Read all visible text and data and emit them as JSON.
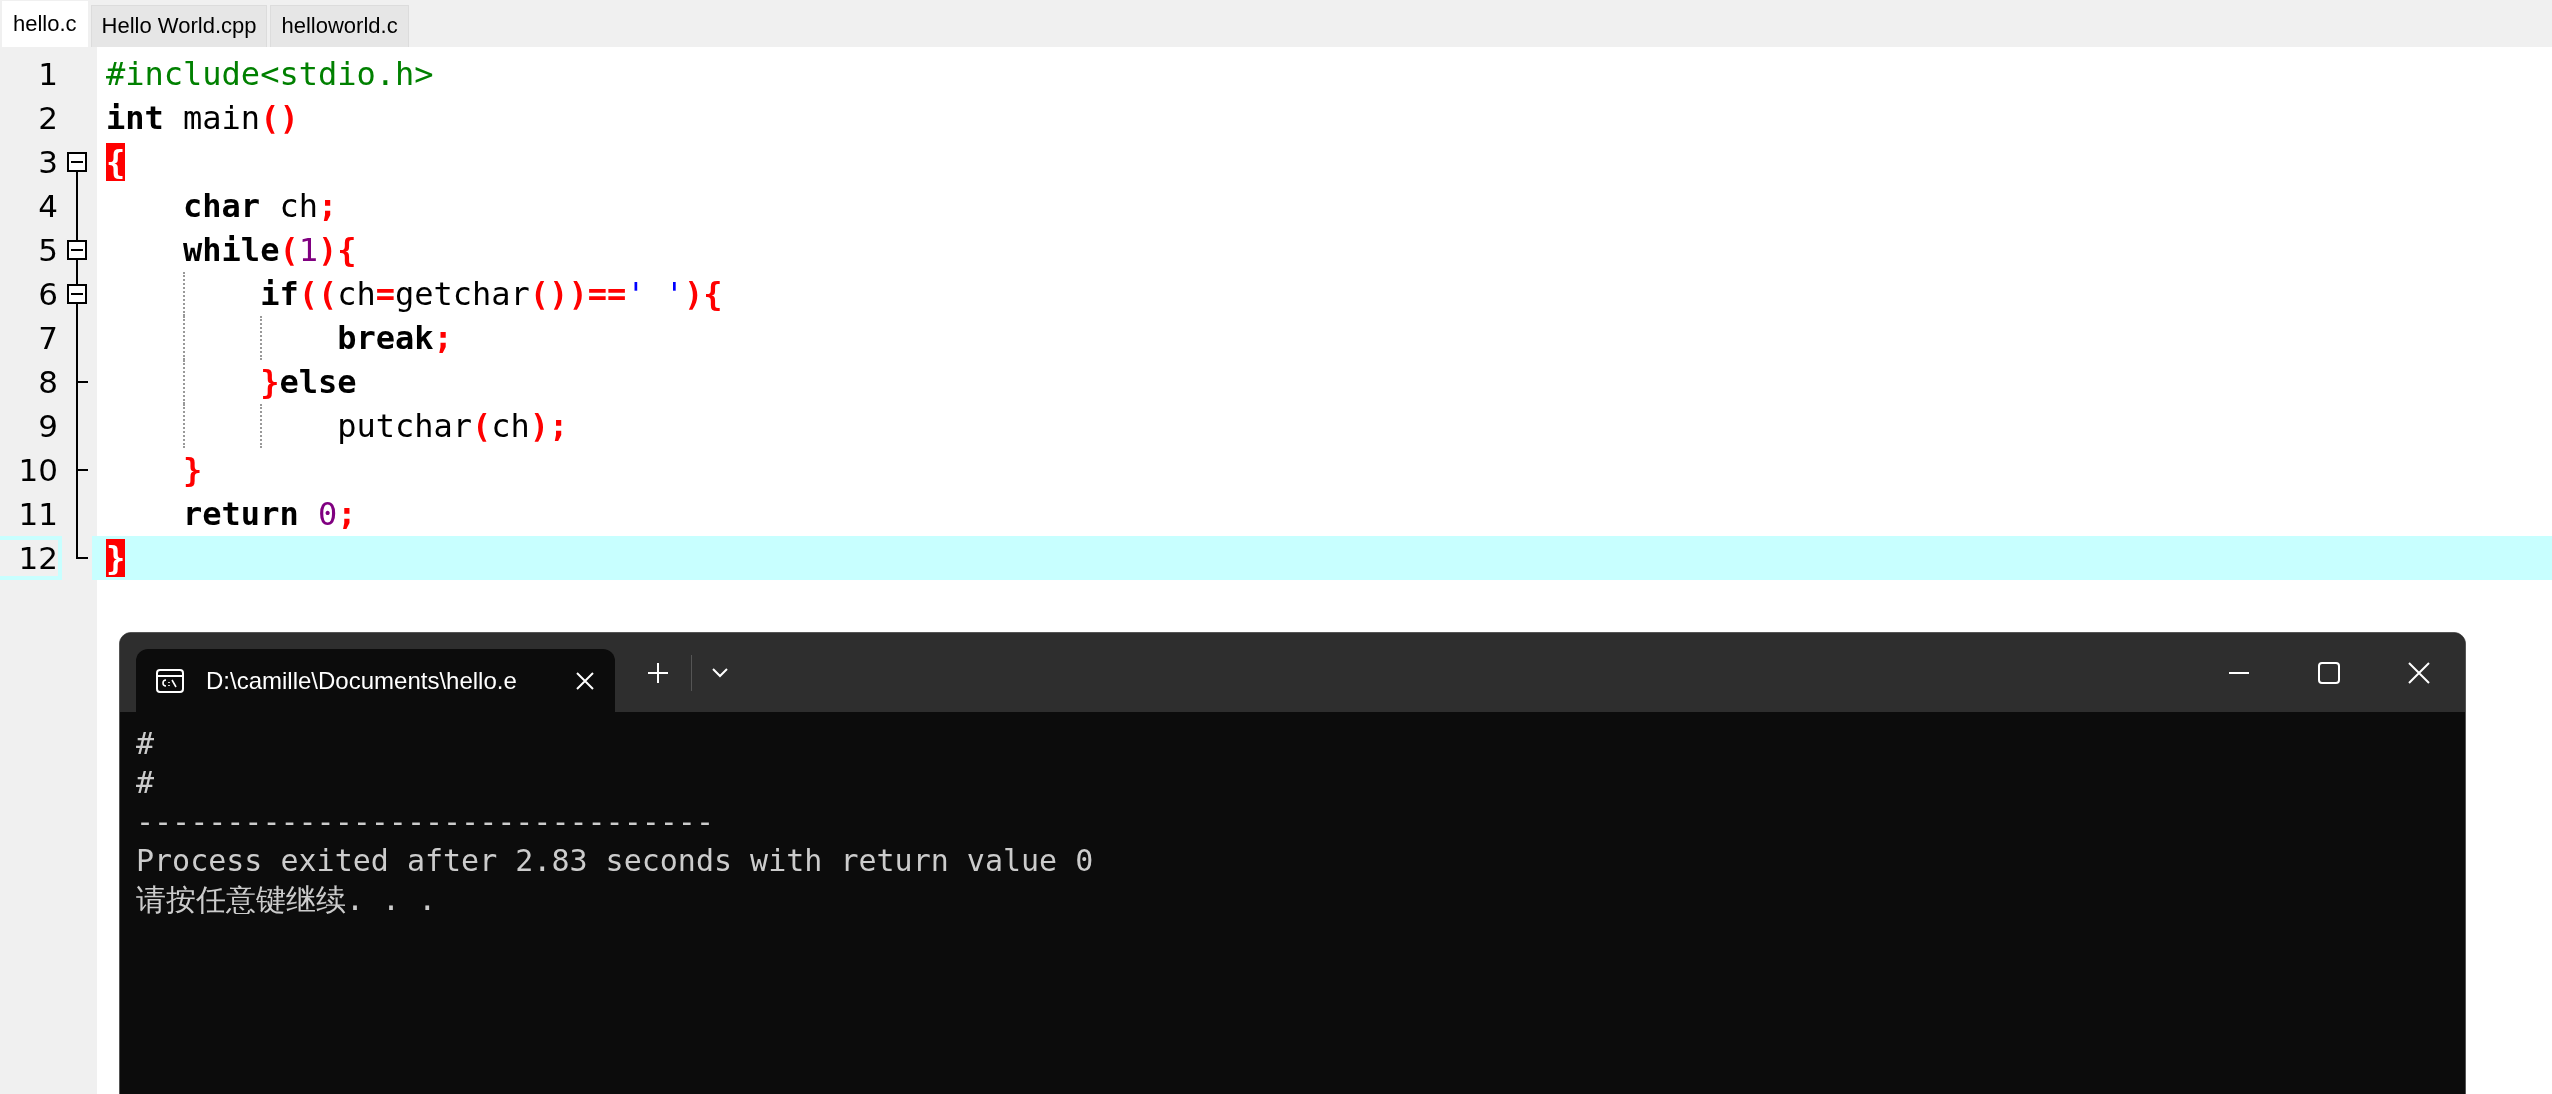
{
  "editor_tabs": [
    {
      "label": "hello.c",
      "selected": true
    },
    {
      "label": "Hello World.cpp",
      "selected": false
    },
    {
      "label": "helloworld.c",
      "selected": false
    }
  ],
  "code_lines": [
    {
      "number": "1",
      "current": false,
      "tokens": [
        {
          "kind": "preprocessor",
          "text": "#include<stdio.h>"
        }
      ]
    },
    {
      "number": "2",
      "current": false,
      "tokens": [
        {
          "kind": "keyword",
          "text": "int"
        },
        {
          "kind": "plain",
          "text": " main"
        },
        {
          "kind": "punct",
          "text": "()"
        }
      ]
    },
    {
      "number": "3",
      "fold": {
        "kind": "box_first"
      },
      "current": false,
      "tokens": [
        {
          "kind": "brace_match",
          "text": "{"
        }
      ]
    },
    {
      "number": "4",
      "fold": {
        "kind": "line"
      },
      "current": false,
      "tokens": [
        {
          "kind": "keyword",
          "text": "    char"
        },
        {
          "kind": "plain",
          "text": " ch"
        },
        {
          "kind": "punct",
          "text": ";"
        }
      ]
    },
    {
      "number": "5",
      "fold": {
        "kind": "box"
      },
      "current": false,
      "tokens": [
        {
          "kind": "keyword",
          "text": "    while"
        },
        {
          "kind": "punct",
          "text": "("
        },
        {
          "kind": "number",
          "text": "1"
        },
        {
          "kind": "punct",
          "text": "){"
        }
      ]
    },
    {
      "number": "6",
      "fold": {
        "kind": "box"
      },
      "current": false,
      "tokens": [
        {
          "kind": "keyword",
          "text": "        if"
        },
        {
          "kind": "punct",
          "text": "(("
        },
        {
          "kind": "plain",
          "text": "ch"
        },
        {
          "kind": "punct",
          "text": "="
        },
        {
          "kind": "plain",
          "text": "getchar"
        },
        {
          "kind": "punct",
          "text": "())=="
        },
        {
          "kind": "string",
          "text": "' '"
        },
        {
          "kind": "punct",
          "text": "){"
        }
      ]
    },
    {
      "number": "7",
      "fold": {
        "kind": "line"
      },
      "current": false,
      "tokens": [
        {
          "kind": "keyword",
          "text": "            break"
        },
        {
          "kind": "punct",
          "text": ";"
        }
      ]
    },
    {
      "number": "8",
      "fold": {
        "kind": "tee"
      },
      "current": false,
      "tokens": [
        {
          "kind": "punct",
          "text": "        }"
        },
        {
          "kind": "keyword",
          "text": "else"
        }
      ]
    },
    {
      "number": "9",
      "fold": {
        "kind": "line"
      },
      "current": false,
      "tokens": [
        {
          "kind": "plain",
          "text": "            putchar"
        },
        {
          "kind": "punct",
          "text": "("
        },
        {
          "kind": "plain",
          "text": "ch"
        },
        {
          "kind": "punct",
          "text": ");"
        }
      ]
    },
    {
      "number": "10",
      "fold": {
        "kind": "tee"
      },
      "current": false,
      "tokens": [
        {
          "kind": "punct",
          "text": "    }"
        }
      ]
    },
    {
      "number": "11",
      "fold": {
        "kind": "line"
      },
      "current": false,
      "tokens": [
        {
          "kind": "keyword",
          "text": "    return "
        },
        {
          "kind": "number",
          "text": "0"
        },
        {
          "kind": "punct",
          "text": ";"
        }
      ]
    },
    {
      "number": "12",
      "fold": {
        "kind": "corner"
      },
      "current": true,
      "tokens": [
        {
          "kind": "brace_match",
          "text": "}"
        }
      ]
    }
  ],
  "terminal": {
    "tab_title": "D:\\camille\\Documents\\hello.e",
    "output": [
      "#",
      "#",
      "--------------------------------",
      "Process exited after 2.83 seconds with return value 0",
      "请按任意键继续. . ."
    ]
  }
}
